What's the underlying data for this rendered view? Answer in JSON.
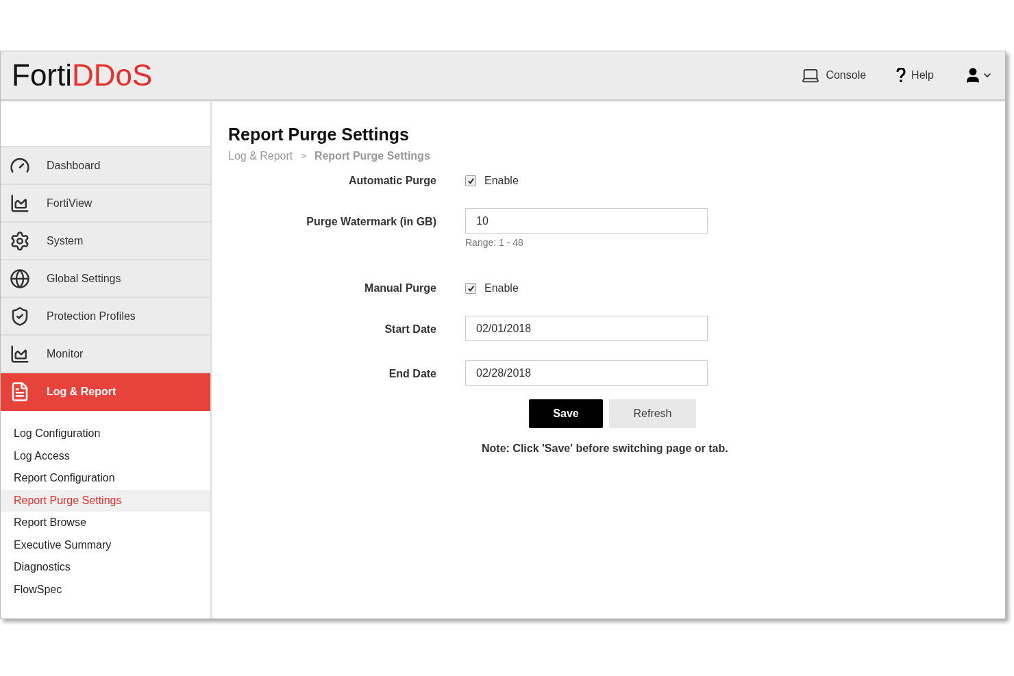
{
  "header": {
    "logo": {
      "prefix": "Forti",
      "suffix": "DDoS"
    },
    "links": [
      {
        "kind": "console",
        "label": "Console"
      },
      {
        "kind": "help",
        "label": "Help"
      },
      {
        "kind": "user"
      }
    ]
  },
  "sidebar": {
    "items": [
      {
        "label": "Dashboard",
        "selected": false
      },
      {
        "label": "FortiView",
        "selected": false
      },
      {
        "label": "System",
        "selected": false
      },
      {
        "label": "Global Settings",
        "selected": false
      },
      {
        "label": "Protection Profiles",
        "selected": false
      },
      {
        "label": "Monitor",
        "selected": false
      },
      {
        "label": "Log & Report",
        "selected": true
      }
    ],
    "subitems": [
      {
        "label": "Log Configuration",
        "selected": false
      },
      {
        "label": "Log Access",
        "selected": false
      },
      {
        "label": "Report Configuration",
        "selected": false
      },
      {
        "label": "Report Purge Settings",
        "selected": true
      },
      {
        "label": "Report Browse",
        "selected": false
      },
      {
        "label": "Executive Summary",
        "selected": false
      },
      {
        "label": "Diagnostics",
        "selected": false
      },
      {
        "label": "FlowSpec",
        "selected": false
      }
    ]
  },
  "page": {
    "title": "Report Purge Settings",
    "breadcrumb": [
      "Log & Report",
      ">",
      "Report Purge Settings"
    ],
    "fields": [
      {
        "kind": "checkbox",
        "label": "Automatic Purge",
        "option": "Enable",
        "checked": true
      },
      {
        "kind": "input",
        "label": "Purge Watermark (in GB)",
        "value": "10",
        "hint": "Range: 1 - 48"
      },
      {
        "kind": "checkbox",
        "label": "Manual Purge",
        "option": "Enable",
        "checked": true
      },
      {
        "kind": "input",
        "label": "Start Date",
        "value": "02/01/2018"
      },
      {
        "kind": "input",
        "label": "End Date",
        "value": "02/28/2018"
      }
    ],
    "buttons": [
      {
        "kind": "primary",
        "label": "Save"
      },
      {
        "kind": "secondary",
        "label": "Refresh"
      }
    ],
    "note": "Note: Click 'Save' before switching page or tab."
  }
}
